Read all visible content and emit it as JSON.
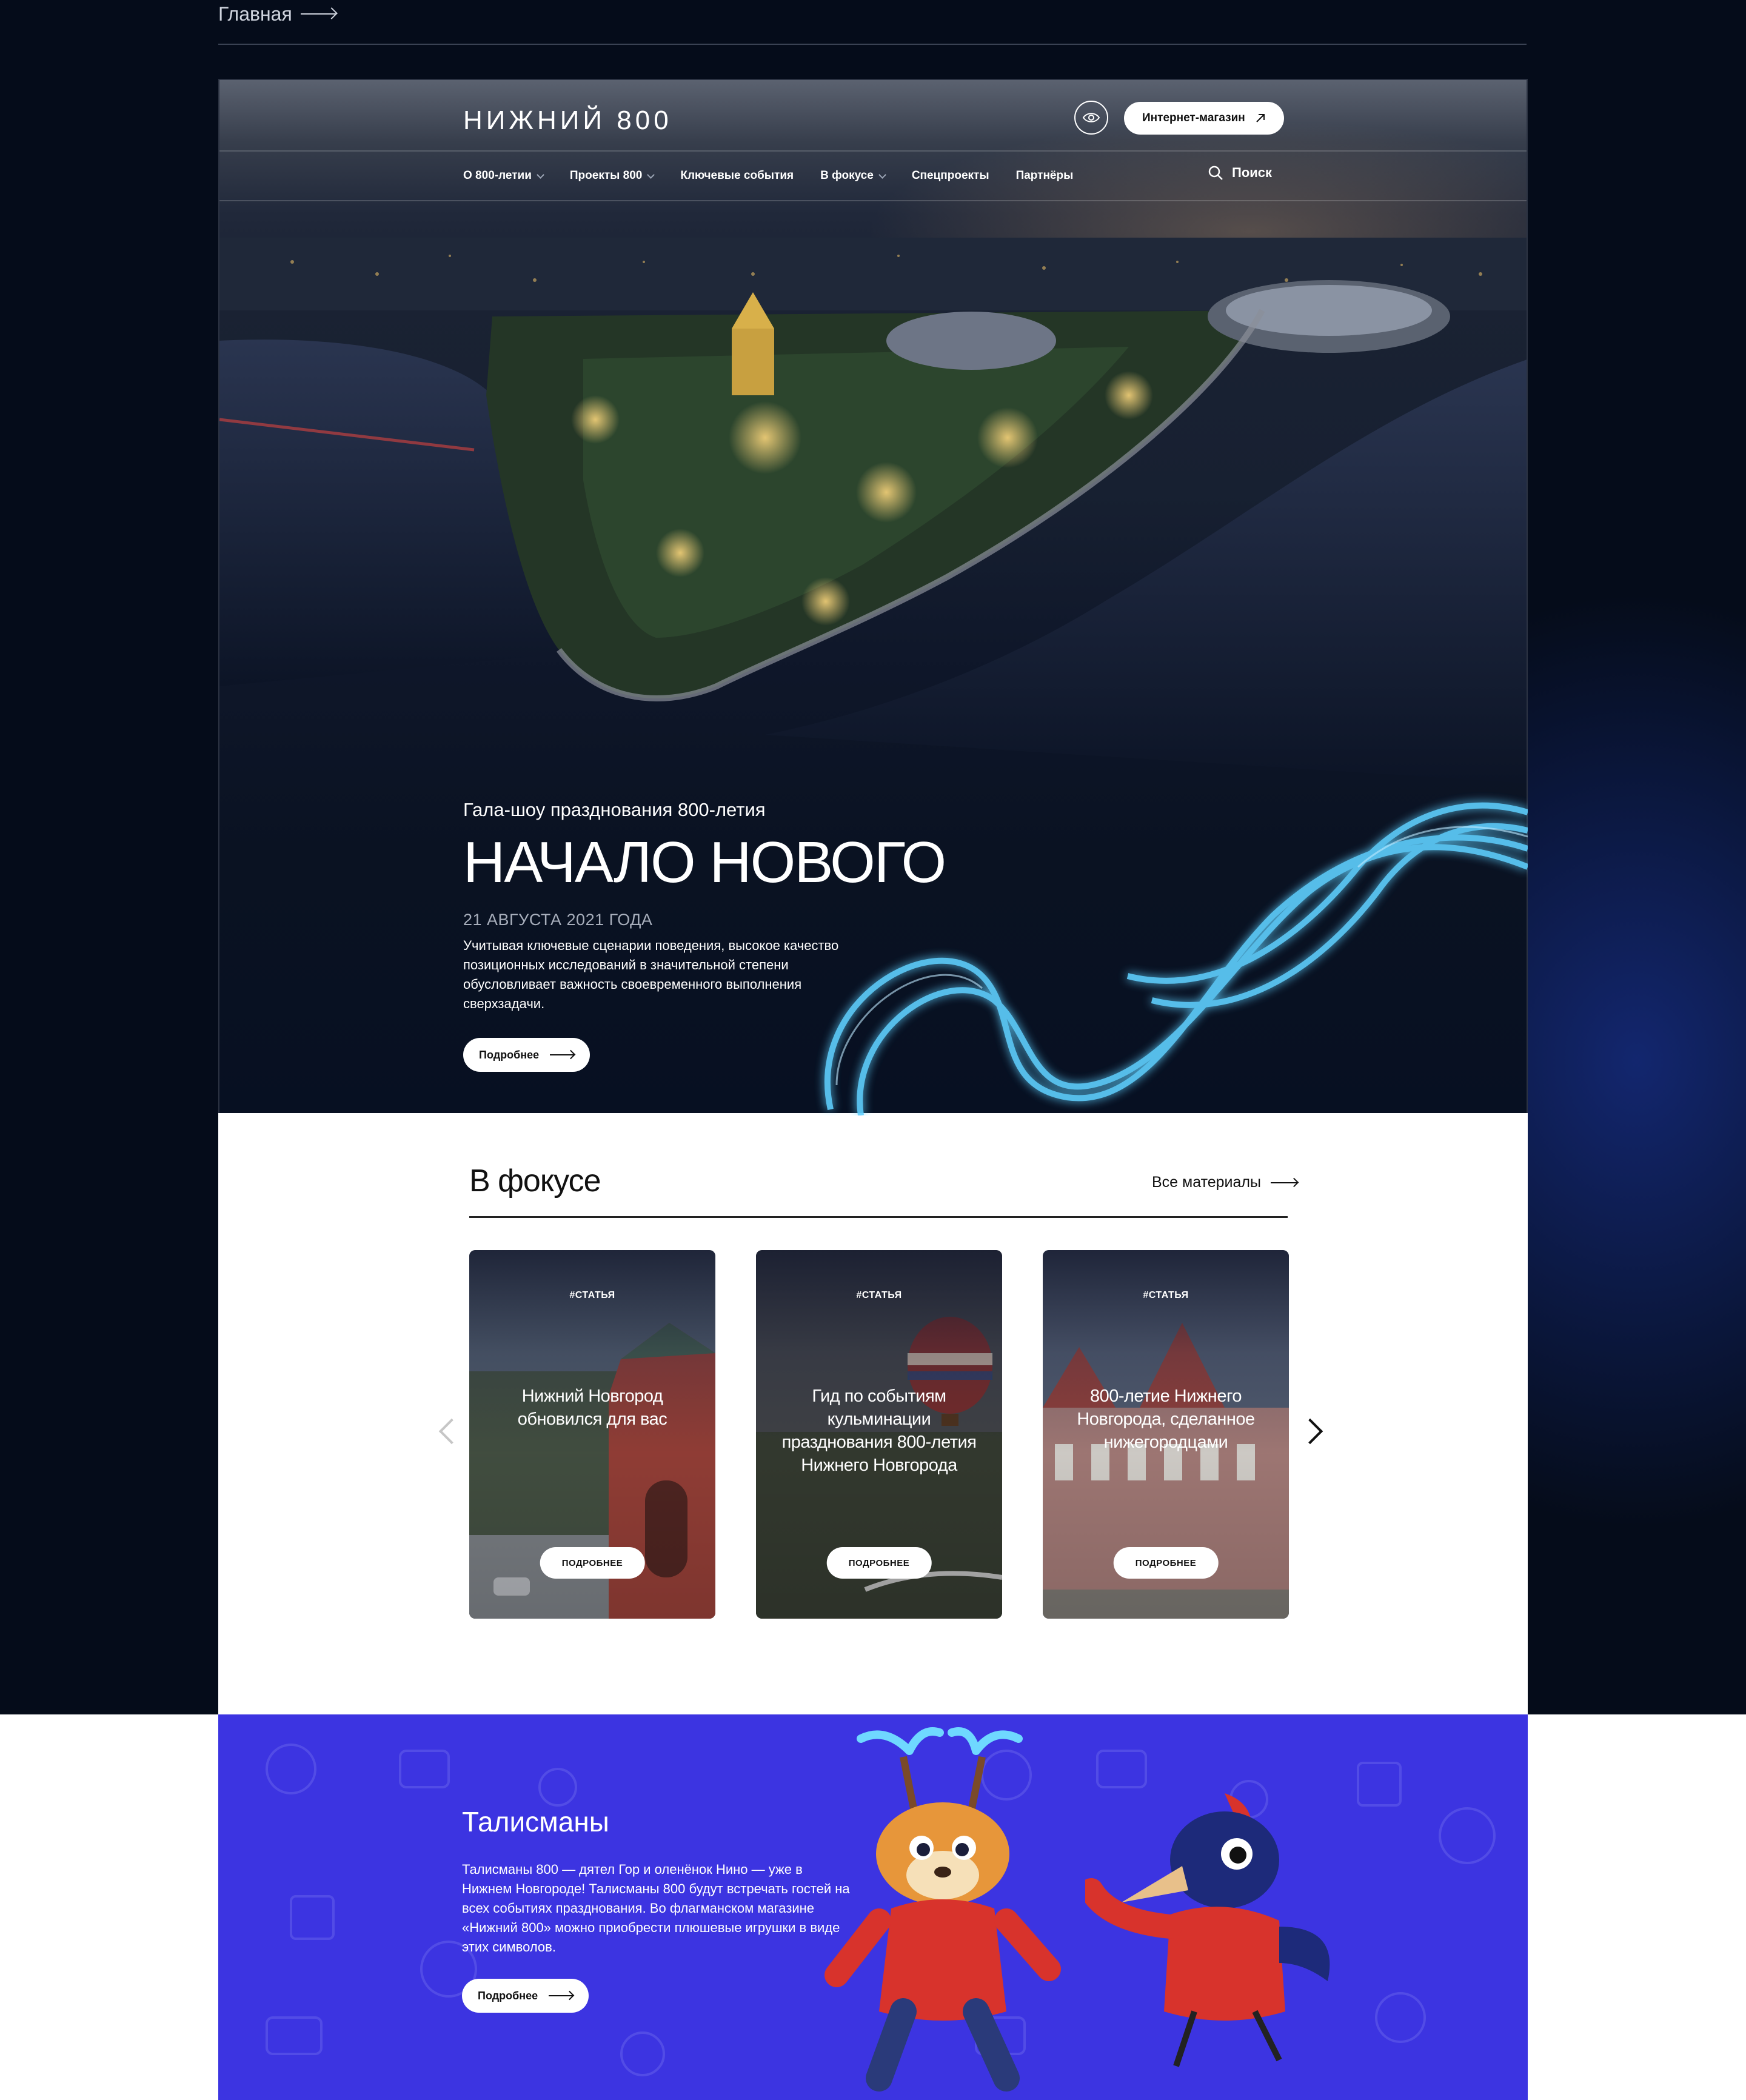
{
  "breadcrumb": {
    "home": "Главная"
  },
  "header": {
    "logo": "НИЖНИЙ 800",
    "shop_label": "Интернет-магазин",
    "search_label": "Поиск",
    "nav": [
      {
        "label": "О 800-летии",
        "dropdown": true
      },
      {
        "label": "Проекты 800",
        "dropdown": true
      },
      {
        "label": "Ключевые события",
        "dropdown": false
      },
      {
        "label": "В фокусе",
        "dropdown": true
      },
      {
        "label": "Спецпроекты",
        "dropdown": false
      },
      {
        "label": "Партнёры",
        "dropdown": false
      }
    ]
  },
  "hero": {
    "subtitle": "Гала-шоу празднования 800-летия",
    "title": "НАЧАЛО НОВОГО",
    "date": "21 АВГУСТА 2021 ГОДА",
    "description": "Учитывая ключевые сценарии поведения, высокое качество позиционных исследований в значительной степени обусловливает важность своевременного выполнения сверхзадачи.",
    "button": "Подробнее"
  },
  "focus": {
    "title": "В фокусе",
    "all_link": "Все материалы",
    "cards": [
      {
        "tag": "#СТАТЬЯ",
        "title": "Нижний Новгород обновился для вас",
        "button": "ПОДРОБНЕЕ"
      },
      {
        "tag": "#СТАТЬЯ",
        "title": "Гид по событиям кульминации празднования 800-летия Нижнего Новгорода",
        "button": "ПОДРОБНЕЕ"
      },
      {
        "tag": "#СТАТЬЯ",
        "title": "800-летие Нижнего Новгорода, сделанное нижегородцами",
        "button": "ПОДРОБНЕЕ"
      }
    ]
  },
  "mascots": {
    "title": "Талисманы",
    "description": "Талисманы 800 — дятел Гор и оленёнок Нино — уже в Нижнем Новгороде! Талисманы 800 будут встречать гостей на всех событиях празднования. Во флагманском магазине «Нижний 800» можно приобрести плюшевые игрушки в виде этих символов.",
    "button": "Подробнее"
  },
  "colors": {
    "mascots_bg": "#3c34e1",
    "page_bg": "#050c1a",
    "neon": "#4fc3ff"
  }
}
